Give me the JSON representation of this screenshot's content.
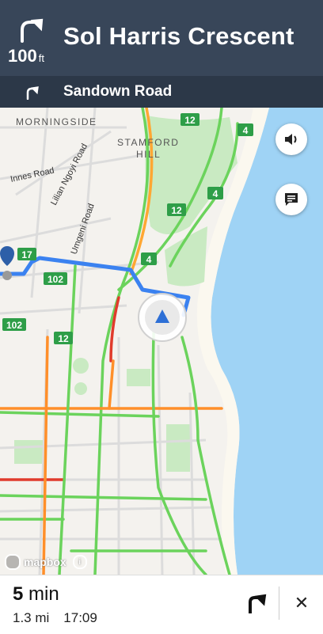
{
  "banner": {
    "distance_value": "100",
    "distance_unit": "ft",
    "street": "Sol Harris Crescent",
    "turn_icon": "turn-right-icon"
  },
  "sub_banner": {
    "street": "Sandown Road",
    "turn_icon": "turn-right-icon"
  },
  "map": {
    "area_labels": [
      "MORNINGSIDE",
      "STAMFORD",
      "HILL"
    ],
    "street_labels": [
      "Innes Road",
      "Lilian Ngoyi Road",
      "Umgeni Road"
    ],
    "route_shields": [
      "12",
      "4",
      "4",
      "12",
      "17",
      "4",
      "102",
      "102",
      "12"
    ],
    "attribution": "mapbox",
    "colors": {
      "water": "#9fd3f5",
      "park": "#c9eac2",
      "route": "#3b82f0",
      "shield": "#2e9e48"
    }
  },
  "controls": {
    "sound_icon": "speaker-icon",
    "report_icon": "feedback-icon"
  },
  "footer": {
    "duration_value": "5",
    "duration_unit": "min",
    "distance": "1.3 mi",
    "arrival": "17:09",
    "close_label": "✕"
  }
}
